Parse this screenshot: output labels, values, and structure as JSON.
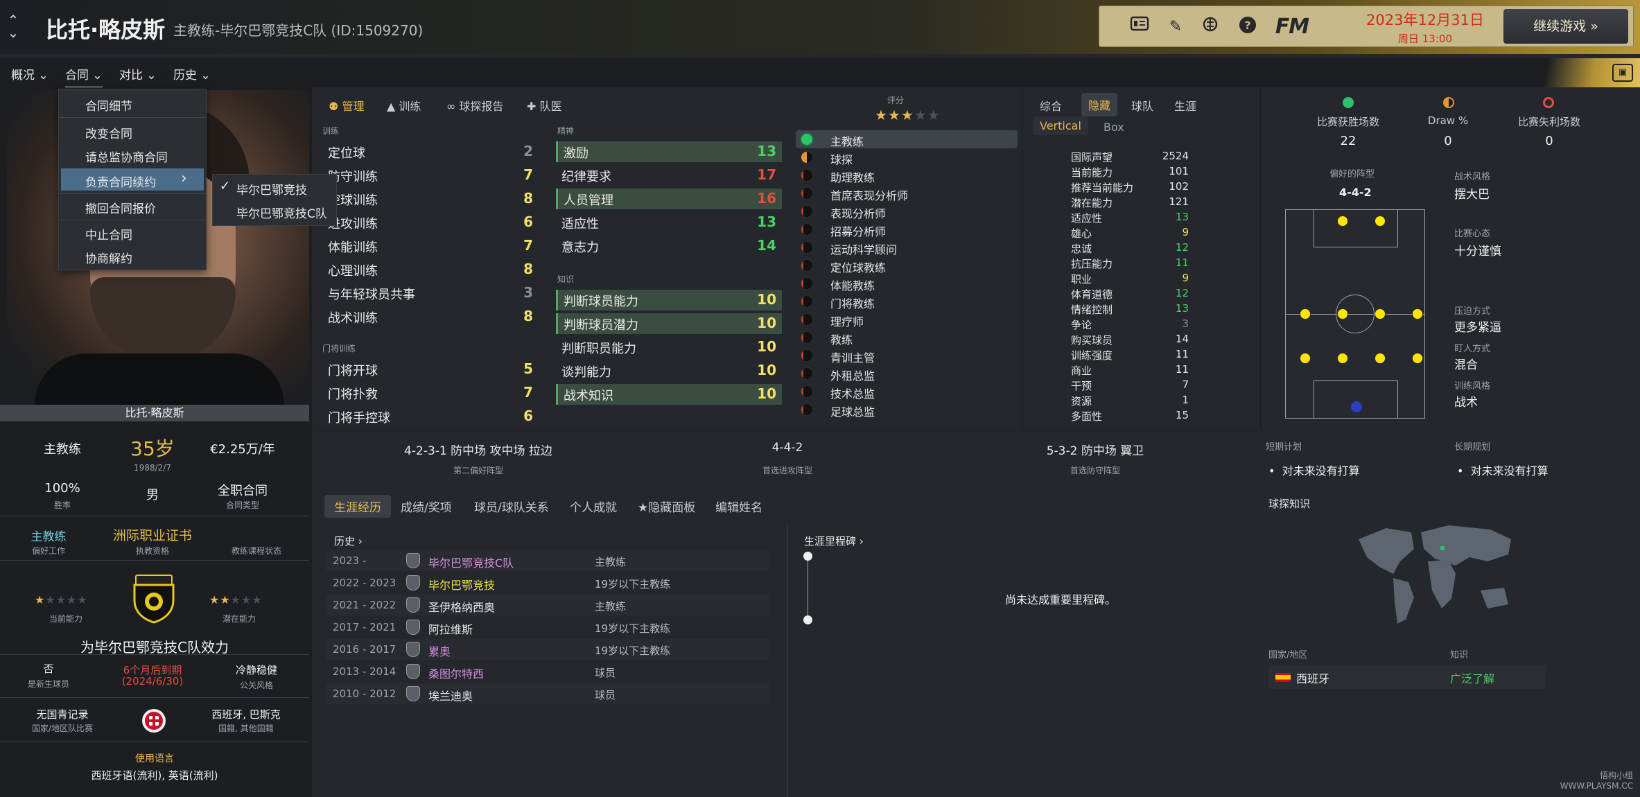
{
  "header": {
    "name": "比托·略皮斯",
    "subtitle": "主教练-毕尔巴鄂竞技C队 (ID:1509270)",
    "fm_logo": "FM",
    "date": "2023年12月31日",
    "day_time": "周日 13:00",
    "continue_label": "继续游戏 »"
  },
  "nav": {
    "items": [
      "概况 ⌄",
      "合同 ⌄",
      "对比 ⌄",
      "历史 ⌄"
    ]
  },
  "dropdown": {
    "items": [
      "合同细节",
      "改变合同",
      "请总监协商合同",
      "负责合同续约",
      "撤回合同报价",
      "中止合同",
      "协商解约"
    ],
    "arrow": "›",
    "submenu": [
      "毕尔巴鄂竞技",
      "毕尔巴鄂竞技C队"
    ],
    "check": "✓"
  },
  "left": {
    "photo_name": "比托·略皮斯",
    "role": "主教练",
    "age": "35岁",
    "birth": "1988/2/7",
    "wage": "€2.25万/年",
    "winrate_val": "100%",
    "winrate_lbl": "胜率",
    "gender": "男",
    "contract_val": "全职合同",
    "contract_lbl": "合同类型",
    "pref_work_val": "主教练",
    "pref_work_lbl": "偏好工作",
    "license_val": "洲际职业证书",
    "license_lbl": "执教资格",
    "course_lbl": "教练课程状态",
    "current_lbl": "当前能力",
    "potential_lbl": "潜在能力",
    "club_line": "为毕尔巴鄂竞技C队效力",
    "new_player_val": "否",
    "new_player_lbl": "是新生球员",
    "expiry_val": "6个月后到期",
    "expiry_date": "(2024/6/30)",
    "pr_style_val": "冷静稳健",
    "pr_style_lbl": "公关风格",
    "youth_val": "无国青记录",
    "youth_lbl": "国家/地区队比赛",
    "nationality_val": "西班牙, 巴斯克",
    "nationality_lbl": "国籍, 其他国籍",
    "lang_lbl": "使用语言",
    "lang_val": "西班牙语(流利), 英语(流利)"
  },
  "attr_tabs": [
    "管理",
    "训练",
    "球探报告",
    "队医"
  ],
  "training": {
    "section": "训练",
    "rows": [
      {
        "name": "定位球",
        "value": "2"
      },
      {
        "name": "防守训练",
        "value": "7"
      },
      {
        "name": "控球训练",
        "value": "8"
      },
      {
        "name": "进攻训练",
        "value": "6"
      },
      {
        "name": "体能训练",
        "value": "7"
      },
      {
        "name": "心理训练",
        "value": "8"
      },
      {
        "name": "与年轻球员共事",
        "value": "3"
      },
      {
        "name": "战术训练",
        "value": "8"
      }
    ],
    "gk_section": "门将训练",
    "gk_rows": [
      {
        "name": "门将开球",
        "value": "5"
      },
      {
        "name": "门将扑救",
        "value": "7"
      },
      {
        "name": "门将手控球",
        "value": "6"
      }
    ]
  },
  "mental": {
    "section": "精神",
    "rows": [
      {
        "name": "激励",
        "value": "13"
      },
      {
        "name": "纪律要求",
        "value": "17"
      },
      {
        "name": "人员管理",
        "value": "16"
      },
      {
        "name": "适应性",
        "value": "13"
      },
      {
        "name": "意志力",
        "value": "14"
      }
    ],
    "knowledge_section": "知识",
    "knowledge_rows": [
      {
        "name": "判断球员能力",
        "value": "10"
      },
      {
        "name": "判断球员潜力",
        "value": "10"
      },
      {
        "name": "判断职员能力",
        "value": "10"
      },
      {
        "name": "谈判能力",
        "value": "10"
      },
      {
        "name": "战术知识",
        "value": "10"
      }
    ]
  },
  "rating": {
    "label": "评分",
    "stars_filled": 3,
    "stars_total": 5
  },
  "staff_roles": [
    "主教练",
    "球探",
    "助理教练",
    "首席表现分析师",
    "表现分析师",
    "招募分析师",
    "运动科学顾问",
    "定位球教练",
    "体能教练",
    "门将教练",
    "理疗师",
    "教练",
    "青训主管",
    "外租总监",
    "技术总监",
    "足球总监"
  ],
  "hidden_tabs": [
    "综合",
    "隐藏",
    "球队",
    "生涯"
  ],
  "hidden_subtabs": [
    "Vertical",
    "Box"
  ],
  "hidden_attrs": [
    {
      "name": "国际声望",
      "value": "2524"
    },
    {
      "name": "当前能力",
      "value": "101"
    },
    {
      "name": "推荐当前能力",
      "value": "102"
    },
    {
      "name": "潜在能力",
      "value": "121"
    },
    {
      "name": "适应性",
      "value": "13"
    },
    {
      "name": "雄心",
      "value": "9"
    },
    {
      "name": "忠诚",
      "value": "12"
    },
    {
      "name": "抗压能力",
      "value": "11"
    },
    {
      "name": "职业",
      "value": "9"
    },
    {
      "name": "体育道德",
      "value": "12"
    },
    {
      "name": "情绪控制",
      "value": "13"
    },
    {
      "name": "争论",
      "value": "3"
    },
    {
      "name": "购买球员",
      "value": "14"
    },
    {
      "name": "训练强度",
      "value": "11"
    },
    {
      "name": "商业",
      "value": "11"
    },
    {
      "name": "干预",
      "value": "7"
    },
    {
      "name": "资源",
      "value": "1"
    },
    {
      "name": "多面性",
      "value": "15"
    }
  ],
  "colors": {
    "accent": "#e6b94e",
    "green": "#4ad066",
    "red": "#e24e42",
    "yellow": "#f1e06a",
    "grey": "#8c9096"
  },
  "formations": [
    {
      "value": "4-2-3-1 防中场 攻中场 拉边",
      "label": "第二偏好阵型"
    },
    {
      "value": "4-4-2",
      "label": "首选进攻阵型"
    },
    {
      "value": "5-3-2 防中场 翼卫",
      "label": "首选防守阵型"
    }
  ],
  "match_stats": [
    {
      "label": "比赛获胜场数",
      "value": "22"
    },
    {
      "label": "Draw %",
      "value": "0"
    },
    {
      "label": "比赛失利场数",
      "value": "0"
    }
  ],
  "tactics": {
    "pref_formation_lbl": "偏好的阵型",
    "pref_formation_val": "4-4-2",
    "style_lbl": "战术风格",
    "style_val": "摆大巴",
    "mentality_lbl": "比赛心态",
    "mentality_val": "十分谨慎",
    "press_lbl": "压迫方式",
    "press_val": "更多紧逼",
    "mark_lbl": "盯人方式",
    "mark_val": "混合",
    "train_lbl": "训练风格",
    "train_val": "战术"
  },
  "plans": {
    "short_lbl": "短期计划",
    "short_val": "对未来没有打算",
    "long_lbl": "长期规划",
    "long_val": "对未来没有打算"
  },
  "bottom_tabs": [
    "生涯经历",
    "成绩/奖项",
    "球员/球队关系",
    "个人成就",
    "★隐藏面板",
    "编辑姓名"
  ],
  "career": {
    "history_lbl": "历史 ›",
    "rows": [
      {
        "years": "2023 -",
        "club": "毕尔巴鄂竞技C队",
        "role": "主教练",
        "color": "#d48ee0"
      },
      {
        "years": "2022 - 2023",
        "club": "毕尔巴鄂竞技",
        "role": "19岁以下主教练",
        "color": "#e6e04a"
      },
      {
        "years": "2021 - 2022",
        "club": "圣伊格纳西奥",
        "role": "主教练",
        "color": "#e6e6e6"
      },
      {
        "years": "2017 - 2021",
        "club": "阿拉维斯",
        "role": "19岁以下主教练",
        "color": "#e6e6e6"
      },
      {
        "years": "2016 - 2017",
        "club": "累奥",
        "role": "19岁以下主教练",
        "color": "#d48ee0"
      },
      {
        "years": "2013 - 2014",
        "club": "桑图尔特西",
        "role": "球员",
        "color": "#d48ee0"
      },
      {
        "years": "2010 - 2012",
        "club": "埃兰迪奥",
        "role": "球员",
        "color": "#e6e6e6"
      }
    ]
  },
  "milestone": {
    "label": "生涯里程碑 ›",
    "empty": "尚未达成重要里程碑。"
  },
  "scouting": {
    "label": "球探知识",
    "country_lbl": "国家/地区",
    "knowledge_lbl": "知识",
    "country_val": "西班牙",
    "knowledge_val": "广泛了解"
  },
  "watermark": "悟构小组 WWW.PLAYSM.CC"
}
